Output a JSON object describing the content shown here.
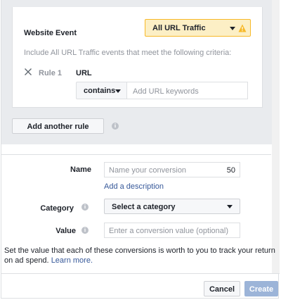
{
  "rule_card": {
    "website_event_label": "Website Event",
    "website_event_value": "All URL Traffic",
    "criteria_text": "Include All URL Traffic events that meet the following criteria:",
    "rule_title": "Rule 1",
    "url_label": "URL",
    "operator_value": "contains",
    "url_placeholder": "Add URL keywords"
  },
  "add_rule_label": "Add another rule",
  "form": {
    "name_label": "Name",
    "name_placeholder": "Name your conversion",
    "name_char_count": "50",
    "add_description": "Add a description",
    "category_label": "Category",
    "category_value": "Select a category",
    "value_label": "Value",
    "value_placeholder": "Enter a conversion value (optional)"
  },
  "helper": {
    "text": "Set the value that each of these conversions is worth to you to track your return on ad spend.",
    "link": "Learn more."
  },
  "footer": {
    "cancel": "Cancel",
    "create": "Create"
  },
  "colors": {
    "warning_bg": "#fcefc5",
    "warning_border": "#f7b928",
    "link": "#365899",
    "create_disabled": "#9cb4d8"
  },
  "icons": [
    "warning-icon",
    "close-icon",
    "chevron-down-icon",
    "info-icon"
  ]
}
